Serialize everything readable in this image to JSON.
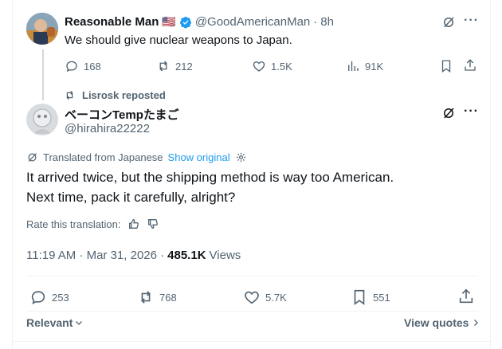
{
  "parent_tweet": {
    "author_name": "Reasonable Man",
    "flag_emoji": "🇺🇸",
    "handle": "@GoodAmericanMan",
    "separator": "·",
    "time": "8h",
    "text": "We should give nuclear weapons to Japan.",
    "replies": "168",
    "reposts": "212",
    "likes": "1.5K",
    "views": "91K"
  },
  "repost_banner": {
    "text": "Lisrosk reposted"
  },
  "main_tweet": {
    "author_name": "ベーコンTempたまご",
    "handle": "@hirahira22222",
    "translated_from": "Translated from Japanese",
    "show_original": "Show original",
    "text_line1": "It arrived twice, but the shipping method is way too American.",
    "text_line2": "Next time, pack it carefully, alright?",
    "rate_translation": "Rate this translation:",
    "timestamp": "11:19 AM · Mar 31, 2026 ·",
    "views_count": "485.1K",
    "views_label": "Views",
    "replies": "253",
    "reposts": "768",
    "likes": "5.7K",
    "bookmarks": "551"
  },
  "footer": {
    "sort_label": "Relevant",
    "view_quotes": "View quotes"
  },
  "colors": {
    "accent": "#1d9bf0",
    "muted": "#536471",
    "verified": "#1d9bf0"
  }
}
